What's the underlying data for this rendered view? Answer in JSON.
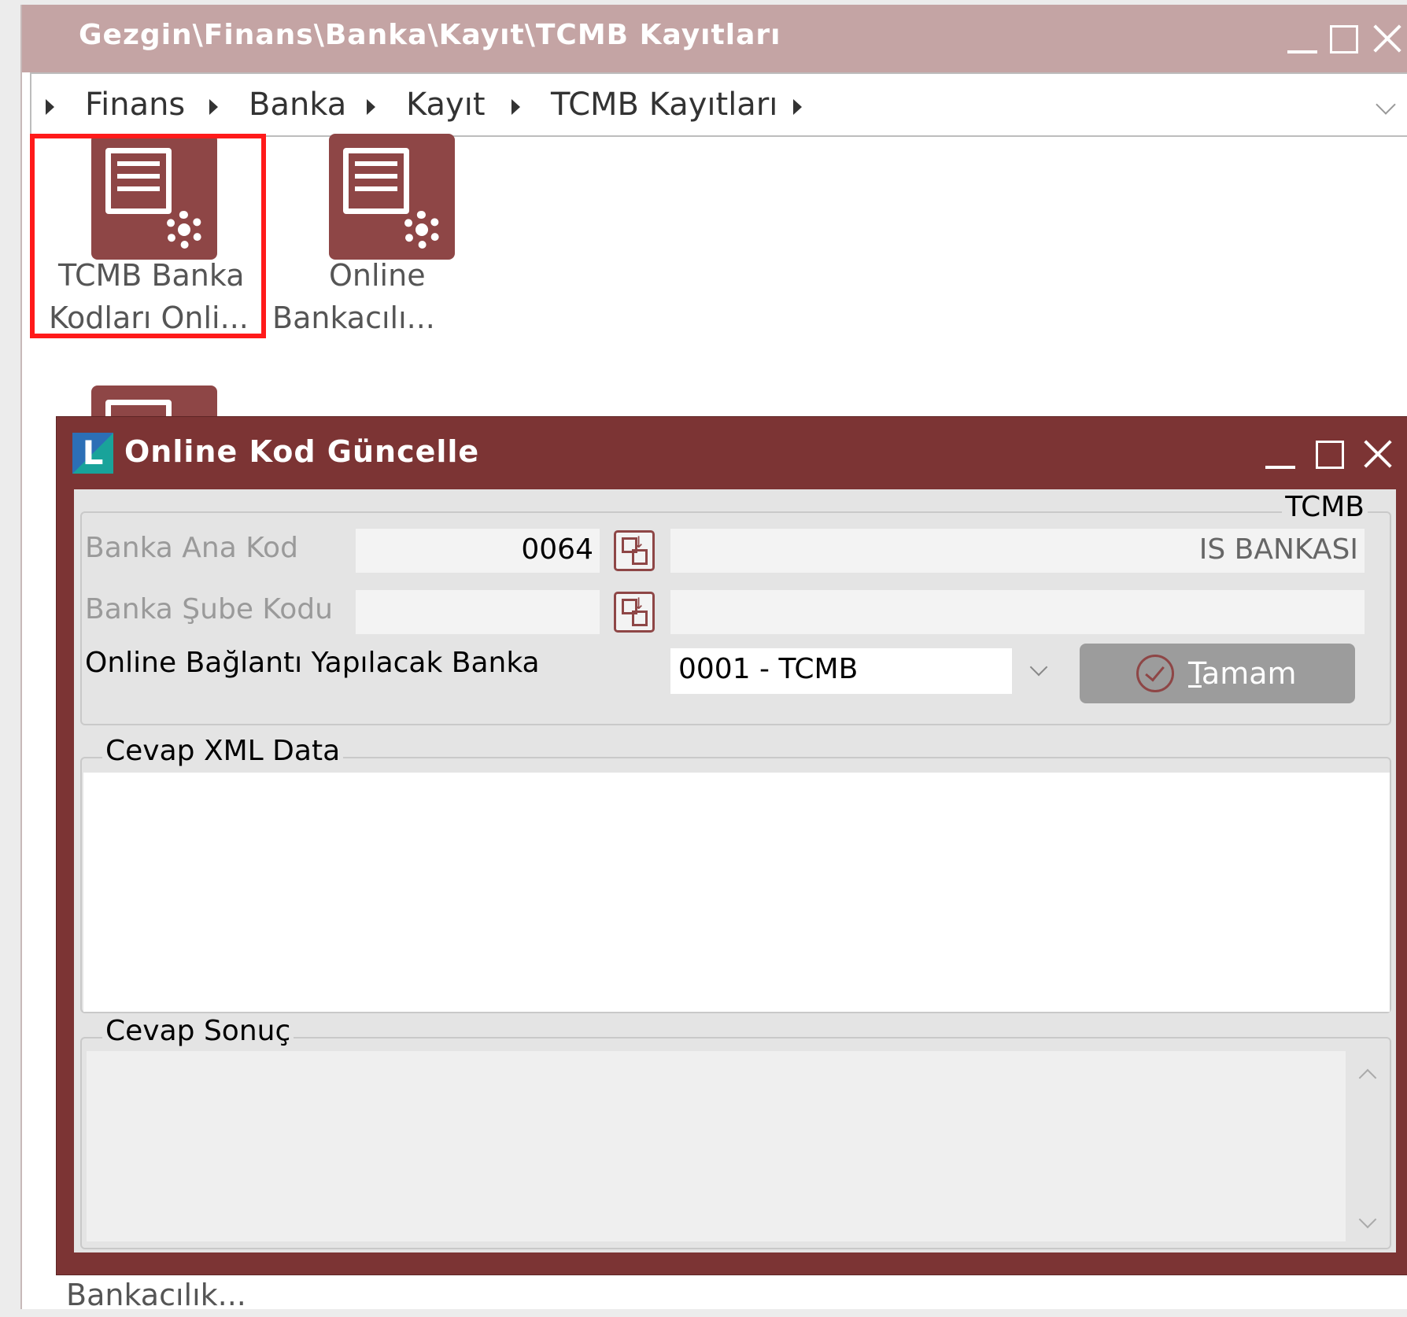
{
  "explorer": {
    "title": "Gezgin\\Finans\\Banka\\Kayıt\\TCMB Kayıtları",
    "breadcrumb": [
      "Finans",
      "Banka",
      "Kayıt",
      "TCMB Kayıtları"
    ],
    "tiles": [
      {
        "label_line1": "TCMB Banka",
        "label_line2": "Kodları Onli...",
        "icon": "document-gear-icon",
        "selected": true
      },
      {
        "label_line1": "Online",
        "label_line2": "Bankacılı...",
        "icon": "document-gear-icon",
        "selected": false
      },
      {
        "label_line1": "Bankacılık...",
        "icon": "document-gear-icon"
      }
    ]
  },
  "dialog": {
    "title": "Online Kod Güncelle",
    "logo_letter": "L",
    "tcmb_group": {
      "caption": "TCMB",
      "bank_main_code": {
        "label": "Banka Ana Kod",
        "value": "0064",
        "description": "IS BANKASI"
      },
      "bank_branch_code": {
        "label": "Banka Şube Kodu",
        "value": "",
        "description": ""
      },
      "online_bank": {
        "label": "Online Bağlantı Yapılacak Banka",
        "selected": "0001 - TCMB"
      },
      "ok_button": {
        "label_first": "T",
        "label_rest": "amam"
      }
    },
    "xml_group": {
      "caption": "Cevap XML Data",
      "content": ""
    },
    "result_group": {
      "caption": "Cevap Sonuç",
      "content": ""
    }
  },
  "colors": {
    "dialog_frame": "#7c3434",
    "tile_icon": "#8e4646",
    "explorer_titlebar": "#c4a4a4",
    "selection": "#ff1a1a",
    "ok_button": "#9c9c9c"
  }
}
